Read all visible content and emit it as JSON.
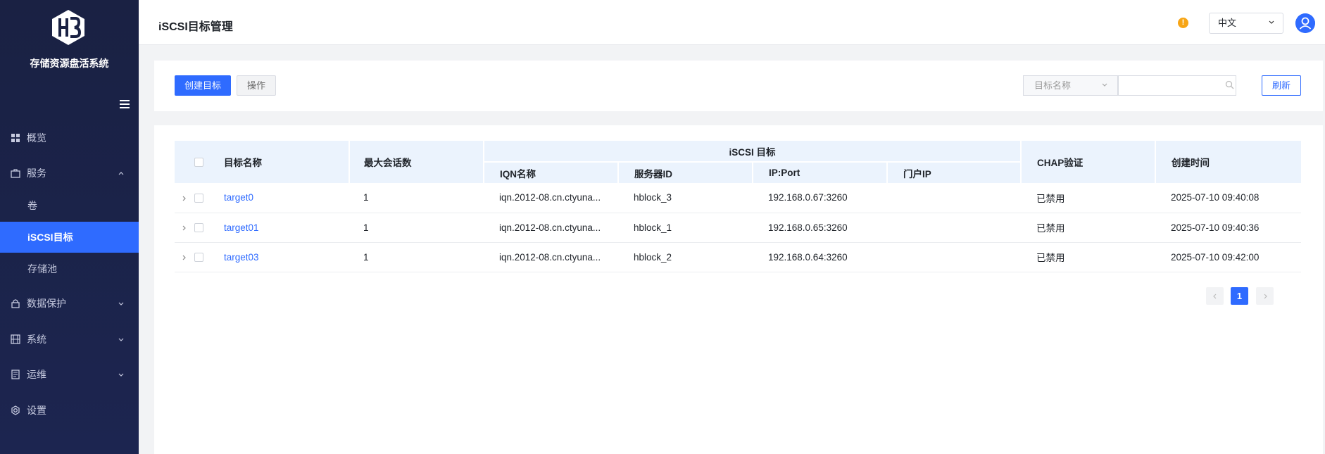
{
  "sidebar": {
    "app_title": "存储资源盘活系统",
    "logo_icon": "hb-logo-icon",
    "items": [
      {
        "label": "概览",
        "icon": "grid-icon"
      },
      {
        "label": "服务",
        "icon": "briefcase-icon"
      },
      {
        "label": "卷"
      },
      {
        "label": "iSCSI目标"
      },
      {
        "label": "存储池"
      },
      {
        "label": "数据保护",
        "icon": "lock-icon"
      },
      {
        "label": "系统",
        "icon": "film-icon"
      },
      {
        "label": "运维",
        "icon": "document-icon"
      },
      {
        "label": "设置",
        "icon": "gear-icon"
      }
    ],
    "active_item": "iSCSI目标"
  },
  "header": {
    "title": "iSCSI目标管理",
    "warn_glyph": "!",
    "language": "中文"
  },
  "toolbar": {
    "create_label": "创建目标",
    "action_label": "操作",
    "filter_label": "目标名称",
    "search_value": "",
    "refresh_label": "刷新"
  },
  "table": {
    "columns": {
      "name": "目标名称",
      "max_sessions": "最大会话数",
      "iscsi_group": "iSCSI 目标",
      "iqn": "IQN名称",
      "server_id": "服务器ID",
      "ip_port": "IP:Port",
      "portal_ip": "门户IP",
      "chap": "CHAP验证",
      "created": "创建时间"
    },
    "rows": [
      {
        "name": "target0",
        "max_sessions": "1",
        "iqn": "iqn.2012-08.cn.ctyuna...",
        "server_id": "hblock_3",
        "ip_port": "192.168.0.67:3260",
        "portal_ip": "",
        "chap": "已禁用",
        "created": "2025-07-10 09:40:08"
      },
      {
        "name": "target01",
        "max_sessions": "1",
        "iqn": "iqn.2012-08.cn.ctyuna...",
        "server_id": "hblock_1",
        "ip_port": "192.168.0.65:3260",
        "portal_ip": "",
        "chap": "已禁用",
        "created": "2025-07-10 09:40:36"
      },
      {
        "name": "target03",
        "max_sessions": "1",
        "iqn": "iqn.2012-08.cn.ctyuna...",
        "server_id": "hblock_2",
        "ip_port": "192.168.0.64:3260",
        "portal_ip": "",
        "chap": "已禁用",
        "created": "2025-07-10 09:42:00"
      }
    ]
  },
  "pagination": {
    "current_page": "1"
  },
  "colors": {
    "accent": "#2f6bff",
    "sidebar_bg": "#1a2143",
    "warning": "#f7a515",
    "header_row_bg": "#ebf3fd"
  }
}
